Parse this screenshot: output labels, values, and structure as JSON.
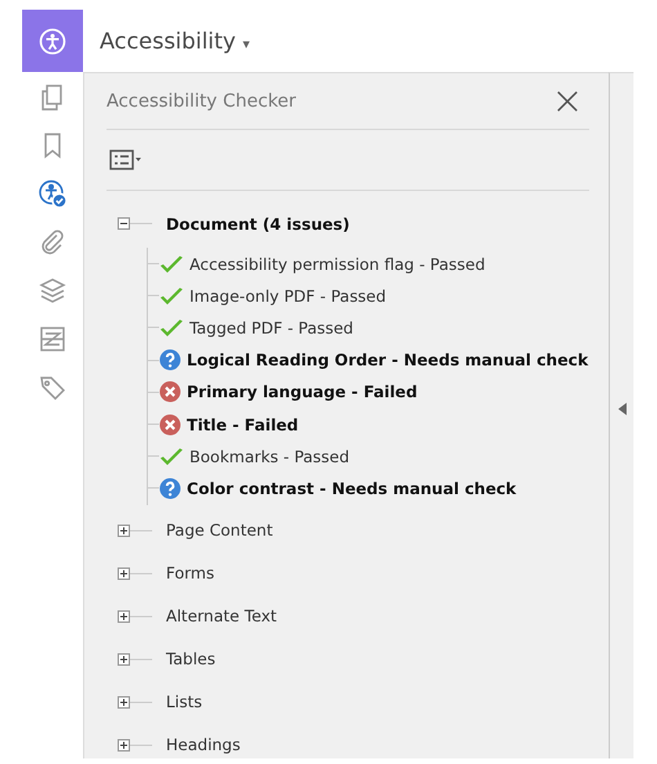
{
  "header": {
    "title": "Accessibility",
    "caret": "▾"
  },
  "sidebar": {
    "tools": [
      {
        "kind": "pages",
        "selected": false
      },
      {
        "kind": "bookmark",
        "selected": false
      },
      {
        "kind": "accessibility",
        "selected": true
      },
      {
        "kind": "attachment",
        "selected": false
      },
      {
        "kind": "layers",
        "selected": false
      },
      {
        "kind": "compare",
        "selected": false
      },
      {
        "kind": "tag",
        "selected": false
      }
    ]
  },
  "panel": {
    "title": "Accessibility Checker",
    "close": "×",
    "tree": [
      {
        "label": "Document (4 issues)",
        "expanded": true,
        "children": [
          {
            "label": "Accessibility permission flag - Passed",
            "kind": "passed"
          },
          {
            "label": "Image-only PDF - Passed",
            "kind": "passed"
          },
          {
            "label": "Tagged PDF - Passed",
            "kind": "passed"
          },
          {
            "label": "Logical Reading Order - Needs manual check",
            "kind": "manual"
          },
          {
            "label": "Primary language - Failed",
            "kind": "failed"
          },
          {
            "label": "Title - Failed",
            "kind": "failed"
          },
          {
            "label": "Bookmarks - Passed",
            "kind": "passed"
          },
          {
            "label": "Color contrast - Needs manual check",
            "kind": "manual"
          }
        ]
      },
      {
        "label": "Page Content",
        "expanded": false
      },
      {
        "label": "Forms",
        "expanded": false
      },
      {
        "label": "Alternate Text",
        "expanded": false
      },
      {
        "label": "Tables",
        "expanded": false
      },
      {
        "label": "Lists",
        "expanded": false
      },
      {
        "label": "Headings",
        "expanded": false
      }
    ]
  }
}
